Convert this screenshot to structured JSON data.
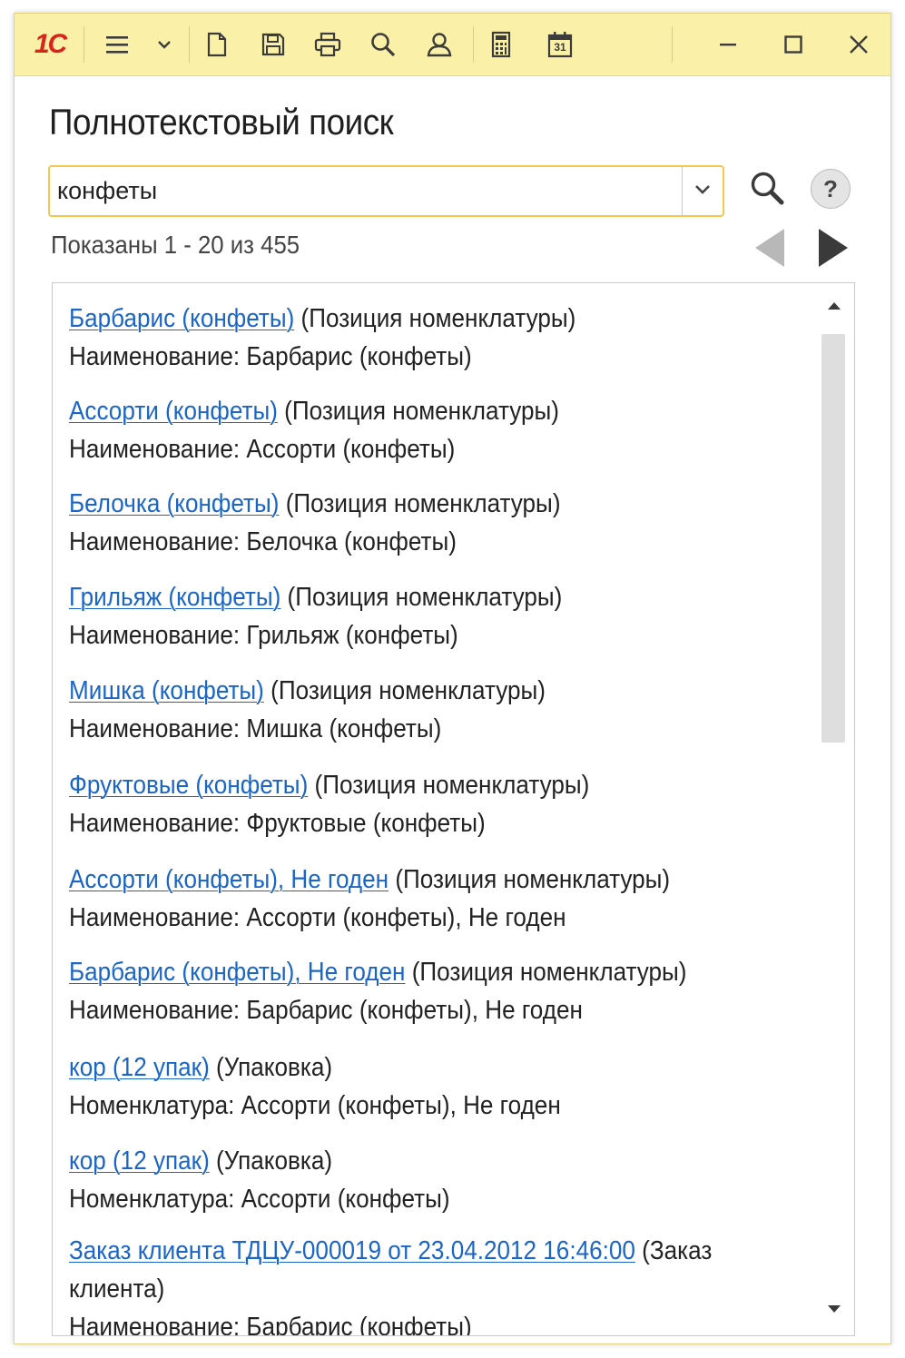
{
  "app": {
    "logo_text": "1С"
  },
  "window": {
    "title": "Полнотекстовый поиск"
  },
  "search": {
    "value": "конфеты"
  },
  "status": {
    "shown": "Показаны 1 - 20 из 455"
  },
  "results": [
    {
      "link": "Барбарис (конфеты)",
      "type": " (Позиция номенклатуры)",
      "detail": "Наименование: Барбарис (конфеты)"
    },
    {
      "link": "Ассорти (конфеты)",
      "type": " (Позиция номенклатуры)",
      "detail": "Наименование: Ассорти (конфеты)"
    },
    {
      "link": "Белочка (конфеты)",
      "type": " (Позиция номенклатуры)",
      "detail": "Наименование: Белочка (конфеты)"
    },
    {
      "link": "Грильяж (конфеты)",
      "type": " (Позиция номенклатуры)",
      "detail": "Наименование: Грильяж (конфеты)"
    },
    {
      "link": "Мишка (конфеты)",
      "type": " (Позиция номенклатуры)",
      "detail": "Наименование: Мишка (конфеты)"
    },
    {
      "link": "Фруктовые (конфеты)",
      "type": " (Позиция номенклатуры)",
      "detail": "Наименование: Фруктовые (конфеты)"
    },
    {
      "link": "Ассорти (конфеты), Не годен",
      "type": " (Позиция номенклатуры)",
      "detail": "Наименование: Ассорти (конфеты), Не годен"
    },
    {
      "link": "Барбарис (конфеты), Не годен",
      "type": " (Позиция номенклатуры)",
      "detail": "Наименование: Барбарис (конфеты), Не годен"
    },
    {
      "link": "кор (12 упак)",
      "type": " (Упаковка)",
      "detail": "Номенклатура: Ассорти (конфеты), Не годен"
    },
    {
      "link": "кор (12 упак)",
      "type": " (Упаковка)",
      "detail": "Номенклатура: Ассорти (конфеты)"
    },
    {
      "link": "Заказ клиента ТДЦУ-000019 от 23.04.2012 16:46:00",
      "type": " (Заказ",
      "type_cont": "клиента)",
      "detail": "Наименование: Барбарис (конфеты)"
    }
  ],
  "icons": {
    "menu": "hamburger-menu-icon",
    "chevron": "chevron-down-icon",
    "new_doc": "document-icon",
    "save": "save-icon",
    "print": "print-icon",
    "find": "search-icon",
    "user": "user-icon",
    "calculator": "calculator-icon",
    "calendar": "calendar-icon",
    "calendar_day": "31",
    "minimize": "minimize-icon",
    "maximize": "maximize-icon",
    "close": "close-icon",
    "help": "?"
  },
  "colors": {
    "titlebar": "#fbf0a8",
    "accent_border": "#f2c94c",
    "link": "#1a65c8",
    "logo_red": "#d8251c"
  }
}
